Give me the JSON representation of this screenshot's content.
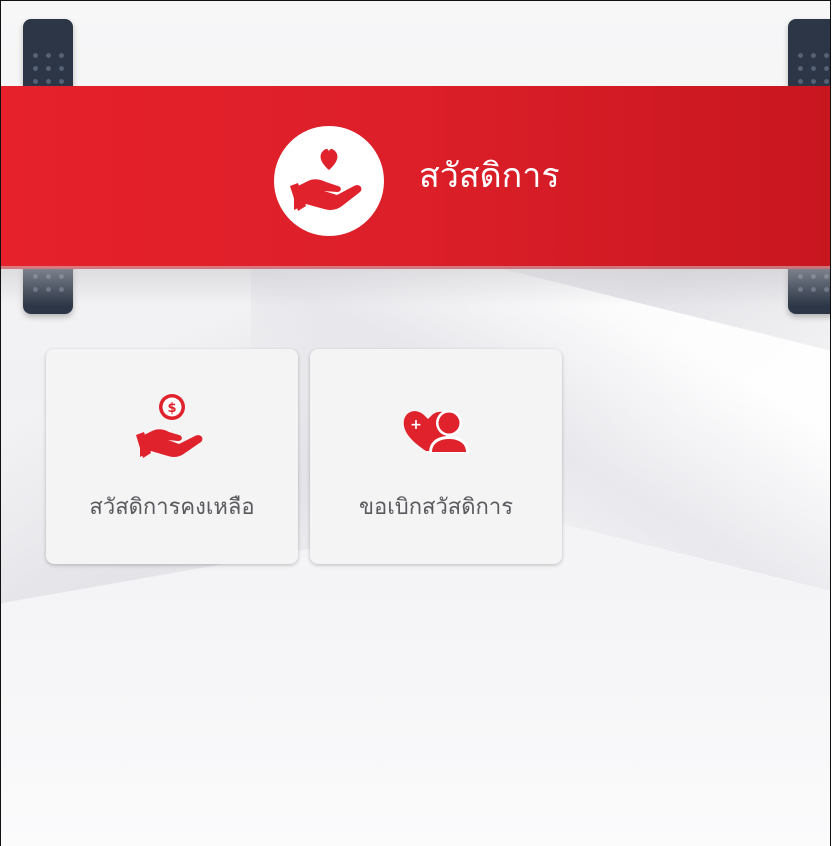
{
  "header": {
    "title": "สวัสดิการ",
    "icon": "heart-hand-icon"
  },
  "menu": {
    "items": [
      {
        "label": "สวัสดิการคงเหลือ",
        "icon": "coin-hand-icon"
      },
      {
        "label": "ขอเบิกสวัสดิการ",
        "icon": "heart-user-icon"
      }
    ]
  },
  "colors": {
    "accent": "#e6212b",
    "side_tab": "#2c3646",
    "card_bg": "#f4f4f5",
    "label_text": "#5a5a5e"
  }
}
